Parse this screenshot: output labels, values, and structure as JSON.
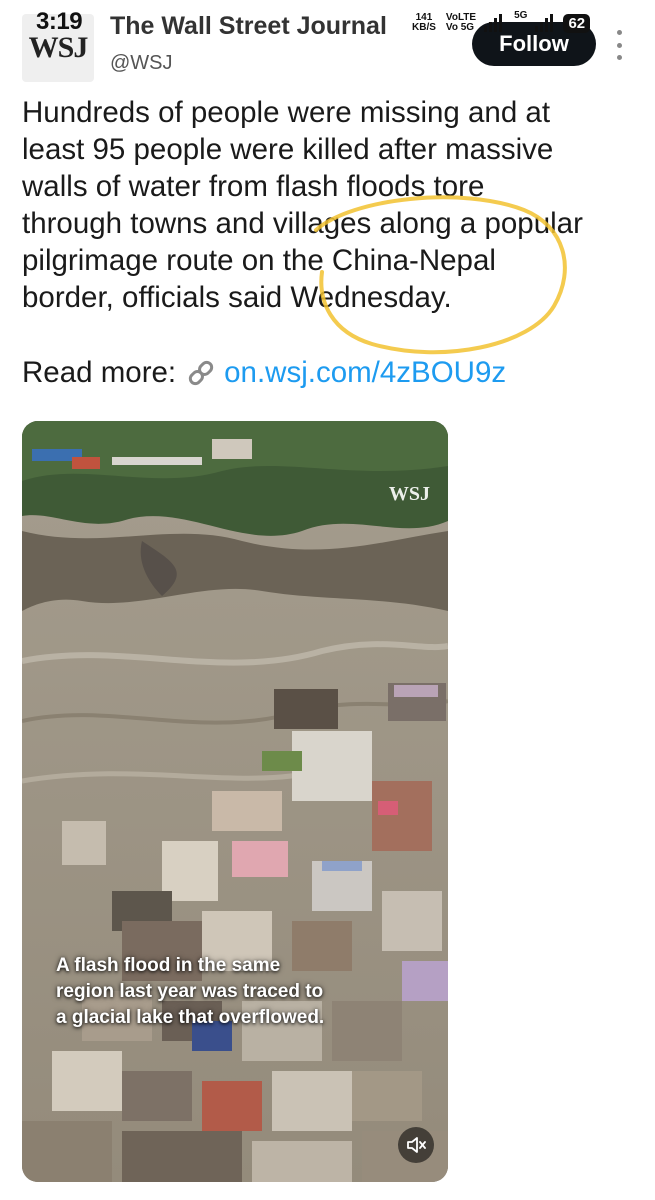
{
  "status_bar": {
    "time": "3:19",
    "net_speed_value": "141",
    "net_speed_unit": "KB/S",
    "volte_1": "VoLTE",
    "volte_2": "Vo 5G",
    "net_type": "5G",
    "battery": "62"
  },
  "author": {
    "avatar_text": "WSJ",
    "name": "The Wall Street Journal",
    "handle": "@WSJ",
    "follow_label": "Follow"
  },
  "tweet": {
    "lines": [
      "Hundreds of people were missing and at",
      "least 95 people were killed after massive",
      "walls of water from flash floods tore",
      "through towns and villages along a popular",
      "pilgrimage route on the China-Nepal",
      "border, officials said Wednesday."
    ],
    "read_more_label": "Read more:",
    "link_text": "on.wsj.com/4zBOU9z"
  },
  "media": {
    "watermark": "WSJ",
    "caption_lines": [
      "A flash flood in the same",
      "region last year was traced to",
      "a glacial lake that overflowed."
    ]
  },
  "icons": {
    "link": "link-icon",
    "more": "more-options-icon",
    "mute": "muted-speaker-icon"
  },
  "colors": {
    "link": "#1d9bf0",
    "follow_bg": "#0f1419",
    "highlight": "#f2c230"
  }
}
